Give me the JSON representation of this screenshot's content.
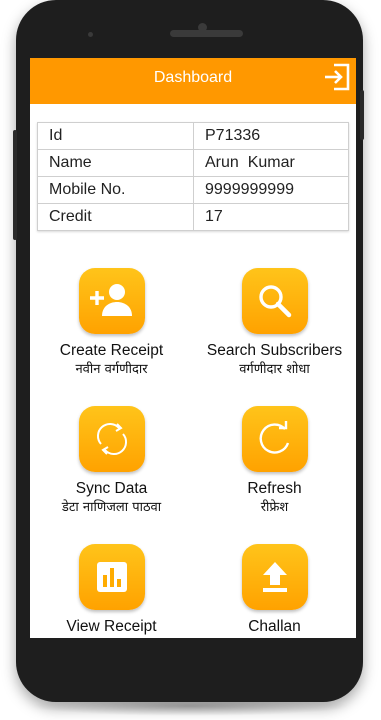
{
  "appbar": {
    "title": "Dashboard",
    "logout_icon": "logout-icon"
  },
  "info": [
    {
      "key": "Id",
      "value": "P71336"
    },
    {
      "key": "Name",
      "value": "Arun  Kumar"
    },
    {
      "key": "Mobile No.",
      "value": "9999999999"
    },
    {
      "key": "Credit",
      "value": "17"
    }
  ],
  "actions": [
    {
      "label": "Create Receipt",
      "sublabel": "नवीन वर्गणीदार",
      "icon": "add-person-icon"
    },
    {
      "label": "Search Subscribers",
      "sublabel": "वर्गणीदार शोधा",
      "icon": "search-icon"
    },
    {
      "label": "Sync Data",
      "sublabel": "डेटा नाणिजला पाठवा",
      "icon": "sync-icon"
    },
    {
      "label": "Refresh",
      "sublabel": "रीफ्रेश",
      "icon": "refresh-icon"
    },
    {
      "label": "View Receipt",
      "sublabel": "",
      "icon": "bar-chart-icon"
    },
    {
      "label": "Challan",
      "sublabel": "",
      "icon": "upload-icon"
    }
  ],
  "colors": {
    "accent": "#ff9800",
    "tile": "#ffb300"
  }
}
